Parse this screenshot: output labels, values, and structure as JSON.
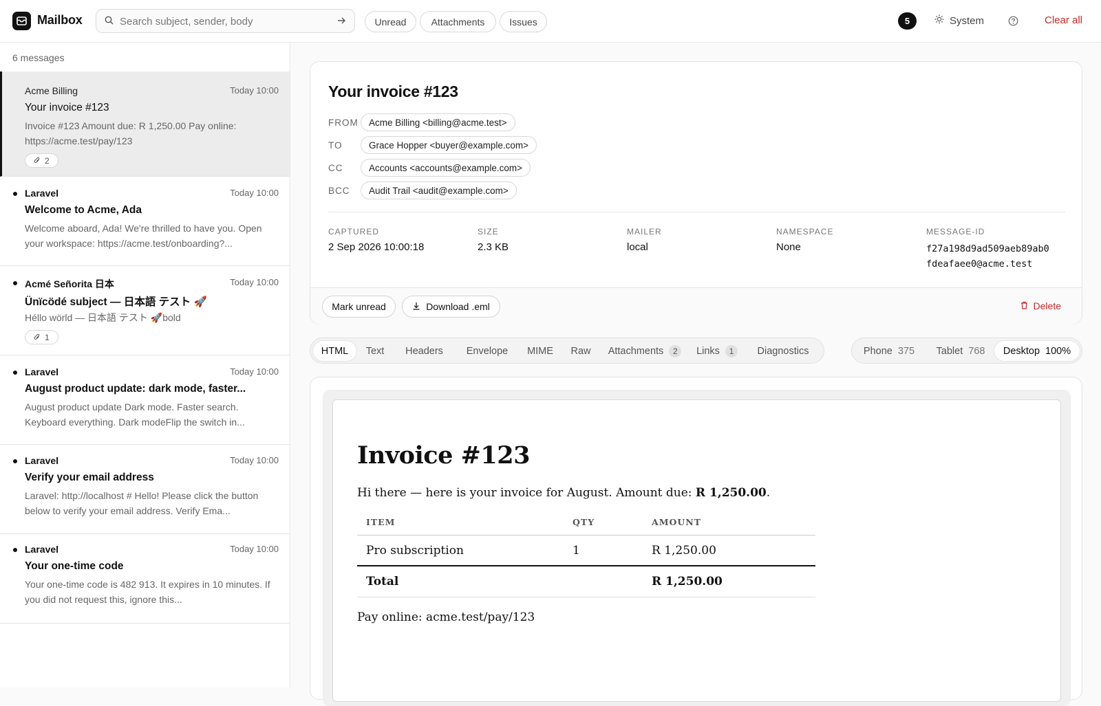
{
  "app": {
    "name": "Mailbox"
  },
  "search": {
    "placeholder": "Search subject, sender, body"
  },
  "filters": [
    "Unread",
    "Attachments",
    "Issues"
  ],
  "header": {
    "count_badge": "5",
    "theme_label": "System",
    "clear_all_label": "Clear all"
  },
  "sidebar": {
    "count_text": "6 messages",
    "messages": [
      {
        "sender": "Acme Billing",
        "time": "Today 10:00",
        "subject": "Your invoice #123",
        "preview": "Invoice #123 Amount due: R 1,250.00 Pay online: https://acme.test/pay/123",
        "attachments": "2",
        "unread": false,
        "selected": true
      },
      {
        "sender": "Laravel",
        "time": "Today 10:00",
        "subject": "Welcome to Acme, Ada",
        "preview": "Welcome aboard, Ada! We're thrilled to have you. Open your workspace: https://acme.test/onboarding?...",
        "attachments": "",
        "unread": true,
        "selected": false
      },
      {
        "sender": "Acmé Señorita 日本",
        "time": "Today 10:00",
        "subject": "Ünïcödé subject — 日本語 テスト 🚀",
        "preview": "Héllo wörld — 日本語 テスト 🚀bold",
        "attachments": "1",
        "unread": true,
        "selected": false
      },
      {
        "sender": "Laravel",
        "time": "Today 10:00",
        "subject": "August product update: dark mode, faster...",
        "preview": "August product update Dark mode. Faster search. Keyboard everything. Dark modeFlip the switch in...",
        "attachments": "",
        "unread": true,
        "selected": false
      },
      {
        "sender": "Laravel",
        "time": "Today 10:00",
        "subject": "Verify your email address",
        "preview": "Laravel: http://localhost # Hello! Please click the button below to verify your email address. Verify Ema...",
        "attachments": "",
        "unread": true,
        "selected": false
      },
      {
        "sender": "Laravel",
        "time": "Today 10:00",
        "subject": "Your one-time code",
        "preview": "Your one-time code is 482 913. It expires in 10 minutes. If you did not request this, ignore this...",
        "attachments": "",
        "unread": true,
        "selected": false
      }
    ]
  },
  "detail": {
    "subject": "Your invoice #123",
    "from_label": "FROM",
    "from": "Acme Billing <billing@acme.test>",
    "to_label": "TO",
    "to": "Grace Hopper <buyer@example.com>",
    "cc_label": "CC",
    "cc": "Accounts <accounts@example.com>",
    "bcc_label": "BCC",
    "bcc": "Audit Trail <audit@example.com>",
    "meta": {
      "captured_label": "CAPTURED",
      "captured": "2 Sep 2026 10:00:18",
      "size_label": "SIZE",
      "size": "2.3 KB",
      "mailer_label": "MAILER",
      "mailer": "local",
      "namespace_label": "NAMESPACE",
      "namespace": "None",
      "message_id_label": "MESSAGE-ID",
      "message_id_line1": "f27a198d9ad509aeb89ab0",
      "message_id_line2": "fdeafaee0@acme.test"
    },
    "actions": {
      "mark_unread": "Mark unread",
      "download": "Download .eml",
      "delete": "Delete"
    }
  },
  "tabs": [
    {
      "label": "HTML",
      "count": "",
      "active": true
    },
    {
      "label": "Text",
      "count": ""
    },
    {
      "label": "Headers",
      "count": ""
    },
    {
      "label": "Envelope",
      "count": ""
    },
    {
      "label": "MIME",
      "count": ""
    },
    {
      "label": "Raw",
      "count": ""
    },
    {
      "label": "Attachments",
      "count": "2"
    },
    {
      "label": "Links",
      "count": "1"
    },
    {
      "label": "Diagnostics",
      "count": ""
    }
  ],
  "viewports": [
    {
      "label": "Phone",
      "value": "375"
    },
    {
      "label": "Tablet",
      "value": "768"
    },
    {
      "label": "Desktop",
      "value": "100%",
      "active": true
    }
  ],
  "email_body": {
    "title": "Invoice #123",
    "intro_text": "Hi there — here is your invoice for August. Amount due: ",
    "intro_amount": "R 1,250.00",
    "intro_end": ".",
    "table_headers": [
      "ITEM",
      "QTY",
      "AMOUNT"
    ],
    "item": {
      "name": "Pro subscription",
      "qty": "1",
      "amount": "R 1,250.00"
    },
    "total": {
      "label": "Total",
      "amount": "R 1,250.00"
    },
    "pay_online": "Pay online: acme.test/pay/123"
  },
  "colors": {
    "accent": "#111111",
    "danger": "#c62828",
    "selected_bg": "#ececec"
  }
}
